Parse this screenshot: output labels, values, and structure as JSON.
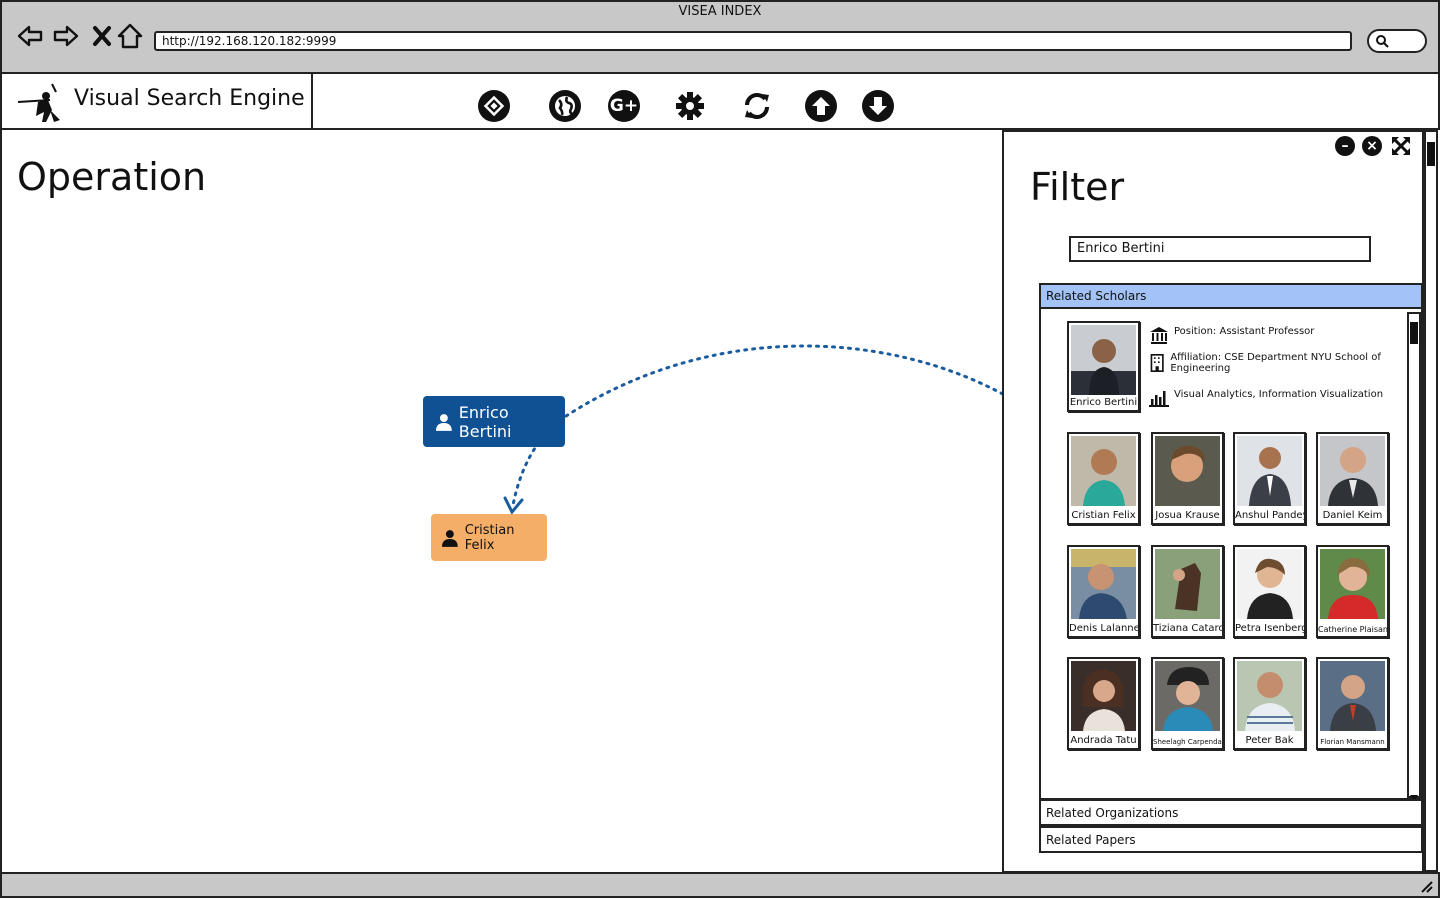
{
  "window": {
    "title": "VISEA INDEX",
    "url": "http://192.168.120.182:9999"
  },
  "app": {
    "title": "Visual Search Engine"
  },
  "toolbar": {
    "icons": [
      "target-icon",
      "globe-icon",
      "google-plus-icon",
      "gear-icon",
      "refresh-icon",
      "arrow-up-icon",
      "arrow-down-icon"
    ],
    "google_plus_label": "G+"
  },
  "operation": {
    "title": "Operation",
    "nodes": {
      "primary": "Enrico Bertini",
      "secondary": "Cristian Felix"
    },
    "colors": {
      "primary": "#0f5192",
      "secondary": "#f5ae68",
      "edge": "#1a5c9e"
    }
  },
  "filter": {
    "title": "Filter",
    "search_value": "Enrico Bertini",
    "sections": {
      "scholars": "Related Scholars",
      "organizations": "Related Organizations",
      "papers": "Related Papers"
    },
    "selected": {
      "name": "Enrico Bertini",
      "position": "Position: Assistant Professor",
      "affiliation": "Affiliation: CSE Department NYU School of Engineering",
      "interests": "Visual Analytics, Information Visualization"
    },
    "scholars": [
      "Cristian Felix",
      "Josua Krause",
      "Anshul Pandey",
      "Daniel Keim",
      "Denis Lalanne",
      "Tiziana Catarci",
      "Petra Isenberg",
      "Catherine Plaisant",
      "Andrada Tatu",
      "Sheelagh Carpendale",
      "Peter Bak",
      "Florian Mansmann"
    ]
  }
}
